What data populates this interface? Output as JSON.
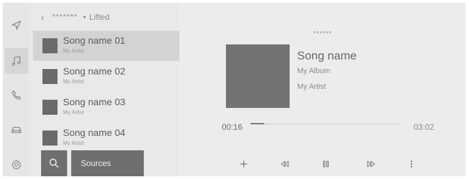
{
  "nav": {
    "breadcrumb_source": "*******",
    "breadcrumb_separator": "•",
    "breadcrumb_current": "Lifted"
  },
  "rail": {
    "items": [
      {
        "icon": "navigation-icon"
      },
      {
        "icon": "music-icon",
        "active": true
      },
      {
        "icon": "phone-icon"
      },
      {
        "icon": "car-icon"
      },
      {
        "icon": "settings-icon"
      }
    ]
  },
  "songs": [
    {
      "title": "Song name 01",
      "artist": "My Artist",
      "selected": true
    },
    {
      "title": "Song name 02",
      "artist": "My Artist"
    },
    {
      "title": "Song name 03",
      "artist": "My Artist"
    },
    {
      "title": "Song name 04",
      "artist": "My Artist"
    }
  ],
  "bottom": {
    "sources_label": "Sources"
  },
  "now_playing": {
    "source_name": "******",
    "title": "Song name",
    "album": "My Album",
    "artist": "My Artist",
    "elapsed": "00:16",
    "total": "03:02",
    "progress_fraction": 0.09
  },
  "colors": {
    "background": "#e9e9e9",
    "selected_row": "#d3d3d3",
    "button_dark": "#6f6f6f",
    "artwork": "#737373"
  }
}
